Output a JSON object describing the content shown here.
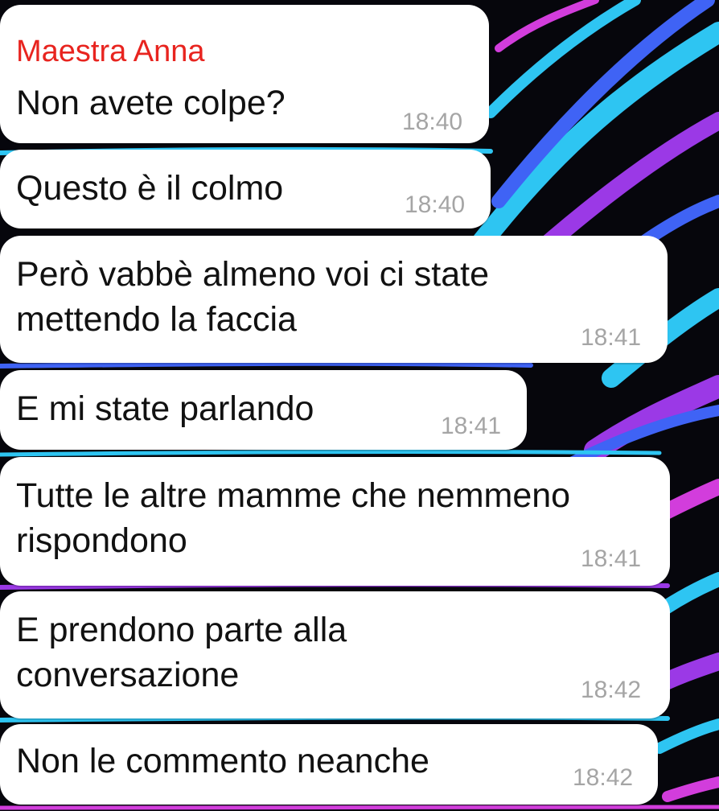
{
  "chat": {
    "sender_name": "Maestra Anna",
    "colors": {
      "sender_name": "#e8241f",
      "bubble_background": "#ffffff",
      "message_text": "#111111",
      "timestamp": "#a5a5a5",
      "wallpaper_base": "#06060c",
      "wallpaper_accents": [
        "#2ec5f2",
        "#3f63f5",
        "#9b39e6",
        "#d23ddc"
      ]
    },
    "messages": [
      {
        "text": "Non avete colpe?",
        "time": "18:40"
      },
      {
        "text": "Questo è il colmo",
        "time": "18:40"
      },
      {
        "text": "Però vabbè almeno voi ci state\nmettendo la faccia",
        "time": "18:41"
      },
      {
        "text": "E mi state parlando",
        "time": "18:41"
      },
      {
        "text": "Tutte le altre mamme che nemmeno\nrispondono",
        "time": "18:41"
      },
      {
        "text": "E prendono parte alla\nconversazione",
        "time": "18:42"
      },
      {
        "text": "Non le commento neanche",
        "time": "18:42"
      }
    ]
  }
}
